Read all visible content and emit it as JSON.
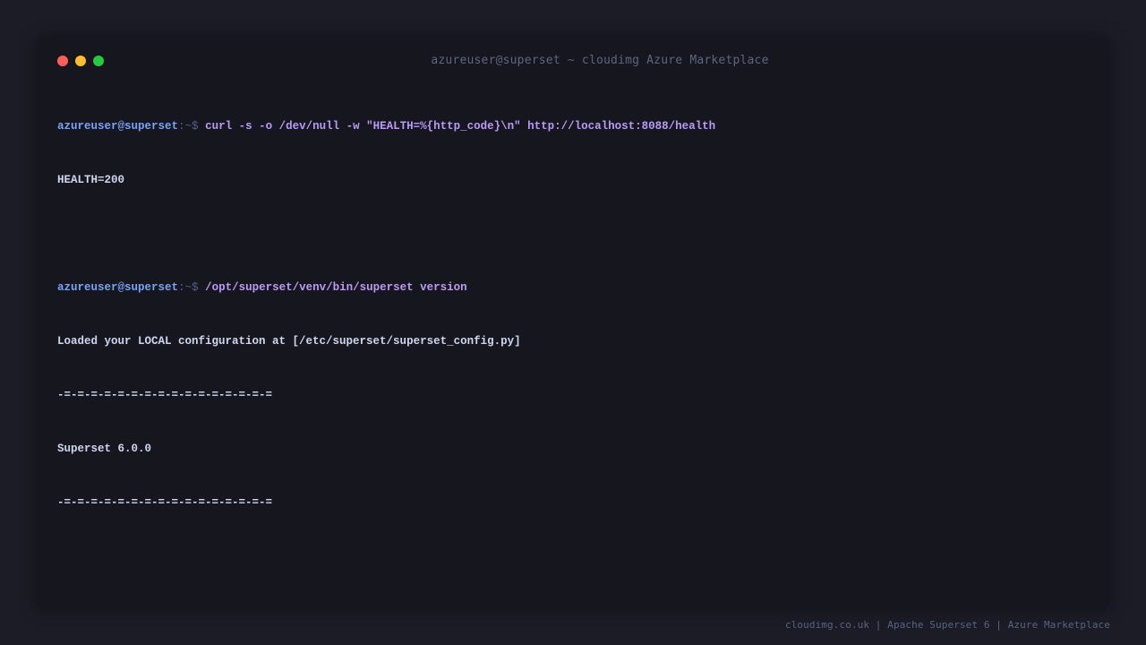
{
  "window": {
    "title": "azureuser@superset ~ cloudimg Azure Marketplace",
    "controls": {
      "close_color": "#ff5f57",
      "minimize_color": "#febc2e",
      "maximize_color": "#28c840"
    }
  },
  "terminal": {
    "prompt_user": "azureuser@superset",
    "prompt_separator": ":~$",
    "lines": [
      {
        "kind": "command",
        "text": "curl -s -o /dev/null -w \"HEALTH=%{http_code}\\n\" http://localhost:8088/health"
      },
      {
        "kind": "output",
        "text": "HEALTH=200"
      },
      {
        "kind": "blank",
        "text": ""
      },
      {
        "kind": "command",
        "text": "/opt/superset/venv/bin/superset version"
      },
      {
        "kind": "output",
        "text": "Loaded your LOCAL configuration at [/etc/superset/superset_config.py]"
      },
      {
        "kind": "output",
        "text": "-=-=-=-=-=-=-=-=-=-=-=-=-=-=-=-="
      },
      {
        "kind": "output",
        "text": "Superset 6.0.0"
      },
      {
        "kind": "output",
        "text": "-=-=-=-=-=-=-=-=-=-=-=-=-=-=-=-="
      }
    ]
  },
  "footer": {
    "text": "cloudimg.co.uk | Apache Superset 6 | Azure Marketplace"
  },
  "colors": {
    "background": "#1b1c25",
    "terminal_background": "#15161e",
    "prompt_user": "#7aa2f7",
    "command": "#bb9af7",
    "output": "#d0d6f0",
    "muted": "#5d6585"
  }
}
